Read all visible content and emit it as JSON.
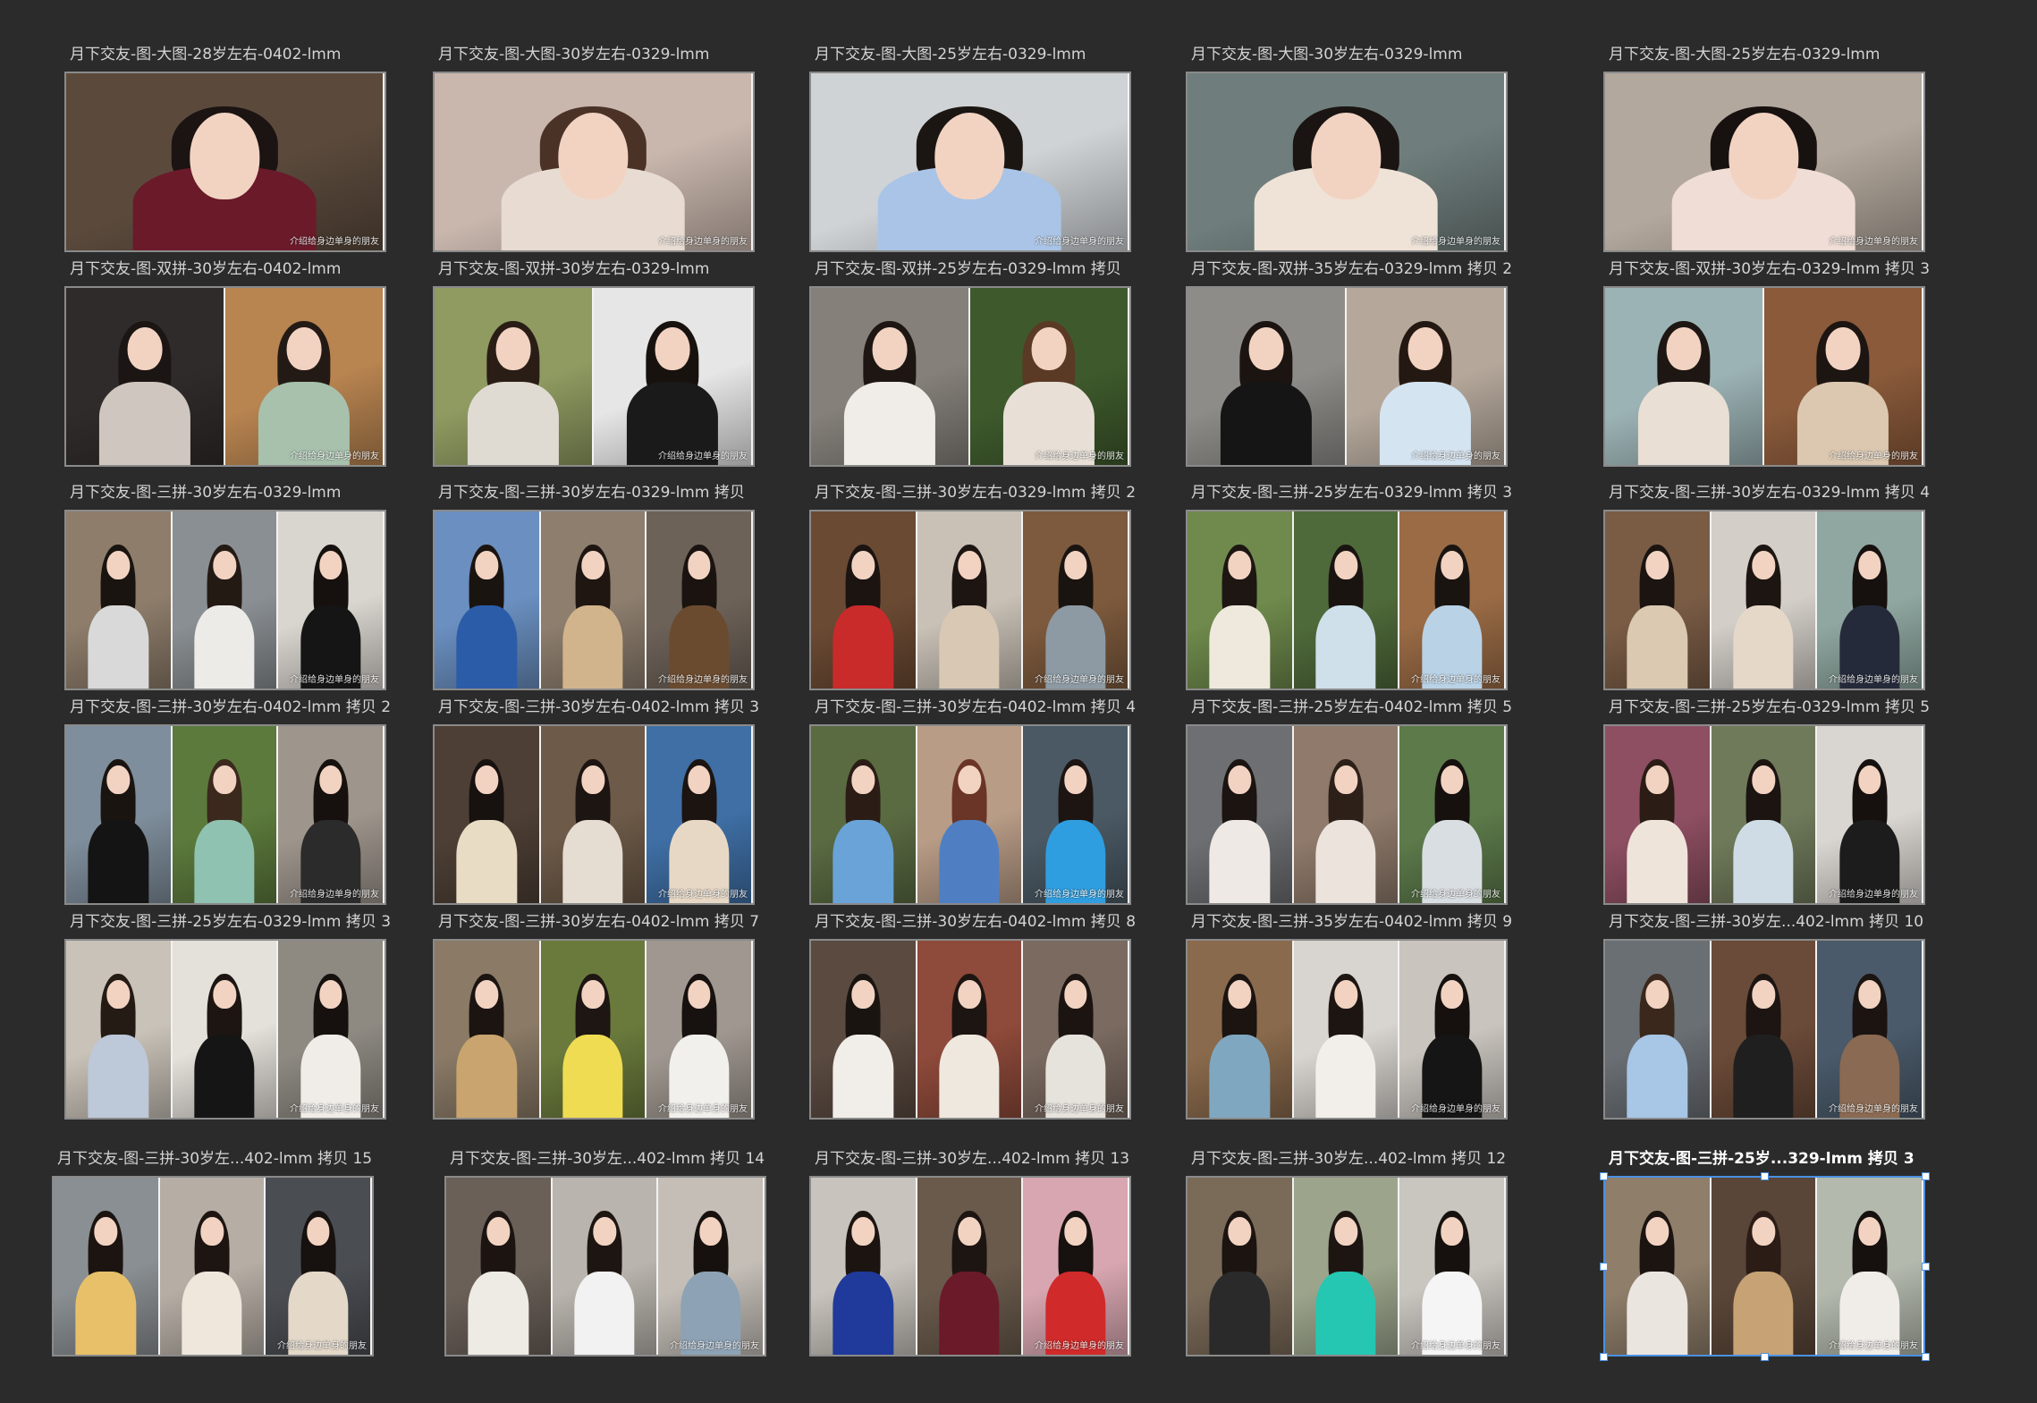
{
  "app": {
    "background": "#2b2b2b",
    "label_color": "#d4d4d4",
    "selection_color": "#4a90e2"
  },
  "watermark_text": "介绍给身边单身的朋友",
  "artboards": [
    {
      "label": "月下交友-图-大图-28岁左右-0402-lmm",
      "panels": [
        {
          "bg": "#5b4a3c",
          "hair": "#1b1412",
          "body": "#6b1a2a"
        }
      ]
    },
    {
      "label": "月下交友-图-大图-30岁左右-0329-lmm",
      "panels": [
        {
          "bg": "#c9b7ad",
          "hair": "#4a3226",
          "body": "#e8dcd2"
        }
      ]
    },
    {
      "label": "月下交友-图-大图-25岁左右-0329-lmm",
      "panels": [
        {
          "bg": "#cfd3d6",
          "hair": "#1c1613",
          "body": "#a9c4e6"
        }
      ]
    },
    {
      "label": "月下交友-图-大图-30岁左右-0329-lmm",
      "panels": [
        {
          "bg": "#6f7e7c",
          "hair": "#1a1412",
          "body": "#efe3d7"
        }
      ]
    },
    {
      "label": "月下交友-图-大图-25岁左右-0329-lmm",
      "panels": [
        {
          "bg": "#b3a89d",
          "hair": "#171110",
          "body": "#f0ddd5"
        }
      ]
    },
    {
      "label": "月下交友-图-双拼-30岁左右-0402-lmm",
      "panels": [
        {
          "bg": "#2f2b2a",
          "hair": "#1b1513",
          "body": "#cfc7bf"
        },
        {
          "bg": "#b88450",
          "hair": "#241a15",
          "body": "#a7c1ad"
        }
      ]
    },
    {
      "label": "月下交友-图-双拼-30岁左右-0329-lmm",
      "panels": [
        {
          "bg": "#8f9b61",
          "hair": "#2a1d16",
          "body": "#e0dbd2"
        },
        {
          "bg": "#e6e6e6",
          "hair": "#18120f",
          "body": "#1a1a1a"
        }
      ]
    },
    {
      "label": "月下交友-图-双拼-25岁左右-0329-lmm 拷贝",
      "panels": [
        {
          "bg": "#85807a",
          "hair": "#1d1612",
          "body": "#f0ede8"
        },
        {
          "bg": "#3e5a2c",
          "hair": "#5a3a25",
          "body": "#e8e0d6"
        }
      ]
    },
    {
      "label": "月下交友-图-双拼-35岁左右-0329-lmm 拷贝 2",
      "panels": [
        {
          "bg": "#8d8c88",
          "hair": "#1b1411",
          "body": "#151515"
        },
        {
          "bg": "#b5a89b",
          "hair": "#241912",
          "body": "#d5e4f1"
        }
      ]
    },
    {
      "label": "月下交友-图-双拼-30岁左右-0329-lmm 拷贝 3",
      "panels": [
        {
          "bg": "#9cb3b5",
          "hair": "#1e1612",
          "body": "#e9dfd4"
        },
        {
          "bg": "#8a5a3a",
          "hair": "#1c1512",
          "body": "#dcc8b0"
        }
      ]
    },
    {
      "label": "月下交友-图-三拼-30岁左右-0329-lmm",
      "panels": [
        {
          "bg": "#8e7d6b",
          "hair": "#1a1410",
          "body": "#d9d9d9"
        },
        {
          "bg": "#8a8f93",
          "hair": "#241a14",
          "body": "#ecebe8"
        },
        {
          "bg": "#d9d5cf",
          "hair": "#16110e",
          "body": "#151515"
        }
      ]
    },
    {
      "label": "月下交友-图-三拼-30岁左右-0329-lmm 拷贝",
      "panels": [
        {
          "bg": "#6a8fc0",
          "hair": "#1a1411",
          "body": "#2b5ca8"
        },
        {
          "bg": "#8d7e6e",
          "hair": "#1f1612",
          "body": "#d2b48c"
        },
        {
          "bg": "#6d6258",
          "hair": "#1a1310",
          "body": "#6b4b30"
        }
      ]
    },
    {
      "label": "月下交友-图-三拼-30岁左右-0329-lmm 拷贝 2",
      "panels": [
        {
          "bg": "#6b4a33",
          "hair": "#1b1411",
          "body": "#c92b2b"
        },
        {
          "bg": "#c9c1b6",
          "hair": "#1d1512",
          "body": "#d8c8b4"
        },
        {
          "bg": "#7d5a3d",
          "hair": "#1a1411",
          "body": "#8d9aa3"
        }
      ]
    },
    {
      "label": "月下交友-图-三拼-25岁左右-0329-lmm 拷贝 3",
      "panels": [
        {
          "bg": "#6f8a4c",
          "hair": "#1d1613",
          "body": "#efe9dd"
        },
        {
          "bg": "#4f6a3a",
          "hair": "#1a1411",
          "body": "#cfe0ea"
        },
        {
          "bg": "#9a6b45",
          "hair": "#1a1411",
          "body": "#b9d2e6"
        }
      ]
    },
    {
      "label": "月下交友-图-三拼-30岁左右-0329-lmm 拷贝 4",
      "panels": [
        {
          "bg": "#7a5c45",
          "hair": "#1b1411",
          "body": "#dbc9b2"
        },
        {
          "bg": "#d3cec8",
          "hair": "#1c1512",
          "body": "#e6d8c9"
        },
        {
          "bg": "#8fa7a0",
          "hair": "#16110e",
          "body": "#252a3a"
        }
      ]
    },
    {
      "label": "月下交友-图-三拼-30岁左右-0402-lmm 拷贝 2",
      "panels": [
        {
          "bg": "#7f8e9c",
          "hair": "#1a1411",
          "body": "#141414"
        },
        {
          "bg": "#5c7a3c",
          "hair": "#3b291d",
          "body": "#8fc2b0"
        },
        {
          "bg": "#9e958c",
          "hair": "#16110e",
          "body": "#2b2b2b"
        }
      ]
    },
    {
      "label": "月下交友-图-三拼-30岁左右-0402-lmm 拷贝 3",
      "panels": [
        {
          "bg": "#4d3f35",
          "hair": "#17110f",
          "body": "#e8dcc4"
        },
        {
          "bg": "#6d5a48",
          "hair": "#1d1512",
          "body": "#e6ddd2"
        },
        {
          "bg": "#3f6fa5",
          "hair": "#1b1411",
          "body": "#e7d8c5"
        }
      ]
    },
    {
      "label": "月下交友-图-三拼-30岁左右-0402-lmm 拷贝 4",
      "panels": [
        {
          "bg": "#5a6b42",
          "hair": "#2b1d15",
          "body": "#6aa3d8"
        },
        {
          "bg": "#b89c86",
          "hair": "#6a3526",
          "body": "#4f7fc2"
        },
        {
          "bg": "#4a5964",
          "hair": "#1c1512",
          "body": "#2f9ee0"
        }
      ]
    },
    {
      "label": "月下交友-图-三拼-25岁左右-0402-lmm 拷贝 5",
      "panels": [
        {
          "bg": "#6d6f72",
          "hair": "#1b1411",
          "body": "#efe9e5"
        },
        {
          "bg": "#8f7a6b",
          "hair": "#2d2018",
          "body": "#ebe3dc"
        },
        {
          "bg": "#5c7a4a",
          "hair": "#16110e",
          "body": "#d9dee3"
        }
      ]
    },
    {
      "label": "月下交友-图-三拼-25岁左右-0329-lmm 拷贝 5",
      "panels": [
        {
          "bg": "#8f4f63",
          "hair": "#2b1c16",
          "body": "#efe4da"
        },
        {
          "bg": "#6f7a5a",
          "hair": "#1b1411",
          "body": "#cfdce6"
        },
        {
          "bg": "#d9d5d0",
          "hair": "#16110e",
          "body": "#1c1c1c"
        }
      ]
    },
    {
      "label": "月下交友-图-三拼-25岁左右-0329-lmm 拷贝 3",
      "panels": [
        {
          "bg": "#c9c2b8",
          "hair": "#241b15",
          "body": "#bdc8d8"
        },
        {
          "bg": "#e4e0da",
          "hair": "#1c1512",
          "body": "#151515"
        },
        {
          "bg": "#8e8a82",
          "hair": "#16110e",
          "body": "#f0ede9"
        }
      ]
    },
    {
      "label": "月下交友-图-三拼-30岁左右-0402-lmm 拷贝 7",
      "panels": [
        {
          "bg": "#8a7a66",
          "hair": "#1b1411",
          "body": "#c9a46e"
        },
        {
          "bg": "#6a7a3c",
          "hair": "#1d1612",
          "body": "#f0dc52"
        },
        {
          "bg": "#a09890",
          "hair": "#17110f",
          "body": "#f2f0ec"
        }
      ]
    },
    {
      "label": "月下交友-图-三拼-30岁左右-0402-lmm 拷贝 8",
      "panels": [
        {
          "bg": "#5a4a40",
          "hair": "#1a1411",
          "body": "#f1ede8"
        },
        {
          "bg": "#8e4a3a",
          "hair": "#1d1512",
          "body": "#efe8de"
        },
        {
          "bg": "#7a6a60",
          "hair": "#1b1411",
          "body": "#e6e2dc"
        }
      ]
    },
    {
      "label": "月下交友-图-三拼-35岁左右-0402-lmm 拷贝 9",
      "panels": [
        {
          "bg": "#8a6a4c",
          "hair": "#1b1411",
          "body": "#7fa8c0"
        },
        {
          "bg": "#d8d4cf",
          "hair": "#1d1512",
          "body": "#f2efea"
        },
        {
          "bg": "#c9c4be",
          "hair": "#16110e",
          "body": "#151515"
        }
      ]
    },
    {
      "label": "月下交友-图-三拼-30岁左...402-lmm 拷贝 10",
      "panels": [
        {
          "bg": "#6a6f74",
          "hair": "#3a281d",
          "body": "#a8c6e6"
        },
        {
          "bg": "#6a4a38",
          "hair": "#1c1512",
          "body": "#1f1f1f"
        },
        {
          "bg": "#4a5a6a",
          "hair": "#1b1411",
          "body": "#8a6a52"
        }
      ]
    },
    {
      "label": "月下交友-图-三拼-30岁左...402-lmm 拷贝 15",
      "panels": [
        {
          "bg": "#8a8f93",
          "hair": "#1b1411",
          "body": "#e8c06a"
        },
        {
          "bg": "#b6aea5",
          "hair": "#1d1512",
          "body": "#efe7dc"
        },
        {
          "bg": "#4a4d52",
          "hair": "#17110f",
          "body": "#e4d8c8"
        }
      ]
    },
    {
      "label": "月下交友-图-三拼-30岁左...402-lmm 拷贝 14",
      "panels": [
        {
          "bg": "#6a6058",
          "hair": "#1b1411",
          "body": "#eeeae4"
        },
        {
          "bg": "#b9b4ad",
          "hair": "#1d1512",
          "body": "#f2f2f2"
        },
        {
          "bg": "#c4beb7",
          "hair": "#16110e",
          "body": "#8da2b5"
        }
      ]
    },
    {
      "label": "月下交友-图-三拼-30岁左...402-lmm 拷贝 13",
      "panels": [
        {
          "bg": "#c8c3bc",
          "hair": "#1b1411",
          "body": "#1f3a9a"
        },
        {
          "bg": "#6a5a4c",
          "hair": "#1d1512",
          "body": "#6b1a2a"
        },
        {
          "bg": "#d8a6b0",
          "hair": "#17110f",
          "body": "#d12a2a"
        }
      ]
    },
    {
      "label": "月下交友-图-三拼-30岁左...402-lmm 拷贝 12",
      "panels": [
        {
          "bg": "#7a6a58",
          "hair": "#1b1411",
          "body": "#2a2a2a"
        },
        {
          "bg": "#9ca58c",
          "hair": "#1d1512",
          "body": "#25c7b2"
        },
        {
          "bg": "#c9c5bf",
          "hair": "#16110e",
          "body": "#f5f5f5"
        }
      ]
    },
    {
      "label": "月下交友-图-三拼-25岁...329-lmm 拷贝 3",
      "selected": true,
      "panels": [
        {
          "bg": "#8f7e6a",
          "hair": "#1b1411",
          "body": "#eae6df"
        },
        {
          "bg": "#5a4638",
          "hair": "#2b1c16",
          "body": "#c7a275"
        },
        {
          "bg": "#b3b9ad",
          "hair": "#16110e",
          "body": "#f0ede8"
        }
      ]
    }
  ]
}
